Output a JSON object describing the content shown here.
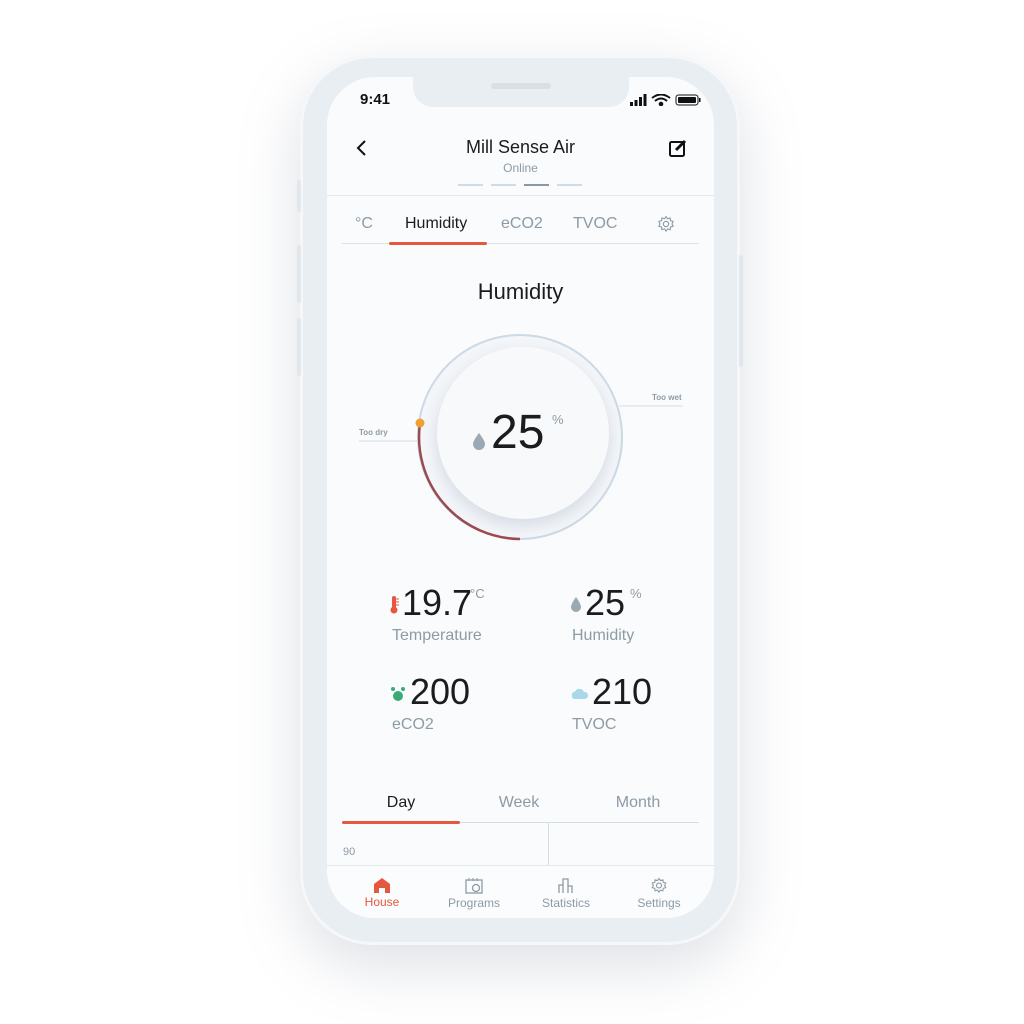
{
  "status_bar": {
    "time": "9:41"
  },
  "header": {
    "title": "Mill Sense Air",
    "subtitle": "Online",
    "page_indicator": {
      "count": 4,
      "active": 3
    }
  },
  "tabs": [
    {
      "label": "°C"
    },
    {
      "label": "Humidity",
      "active": true
    },
    {
      "label": "eCO2"
    },
    {
      "label": "TVOC"
    },
    {
      "icon": "gear-icon"
    }
  ],
  "gauge": {
    "title": "Humidity",
    "value": "25",
    "unit": "%",
    "low_label": "Too dry",
    "high_label": "Too wet",
    "icon": "drop-icon",
    "colors": {
      "dot": "#f0a030",
      "arc": "#9a4a50"
    }
  },
  "readings": [
    {
      "value": "19.7",
      "unit": "°C",
      "label": "Temperature",
      "icon": "thermometer-icon",
      "color": "#e5573f"
    },
    {
      "value": "25",
      "unit": "%",
      "label": "Humidity",
      "icon": "drop-icon",
      "color": "#9aa9b2"
    },
    {
      "value": "200",
      "unit": "",
      "label": "eCO2",
      "icon": "eco2-icon",
      "color": "#3aaa78"
    },
    {
      "value": "210",
      "unit": "",
      "label": "TVOC",
      "icon": "cloud-icon",
      "color": "#a8d8ea"
    }
  ],
  "periods": [
    {
      "label": "Day",
      "active": true
    },
    {
      "label": "Week"
    },
    {
      "label": "Month"
    }
  ],
  "chart": {
    "y_tick": "90"
  },
  "bottom_nav": [
    {
      "label": "House",
      "active": true,
      "icon": "house-icon"
    },
    {
      "label": "Programs",
      "icon": "calendar-clock-icon"
    },
    {
      "label": "Statistics",
      "icon": "bar-chart-icon"
    },
    {
      "label": "Settings",
      "icon": "gear-icon"
    }
  ],
  "colors": {
    "accent": "#e5573f",
    "text": "#1a1c1e",
    "muted": "#8d9ba5"
  }
}
